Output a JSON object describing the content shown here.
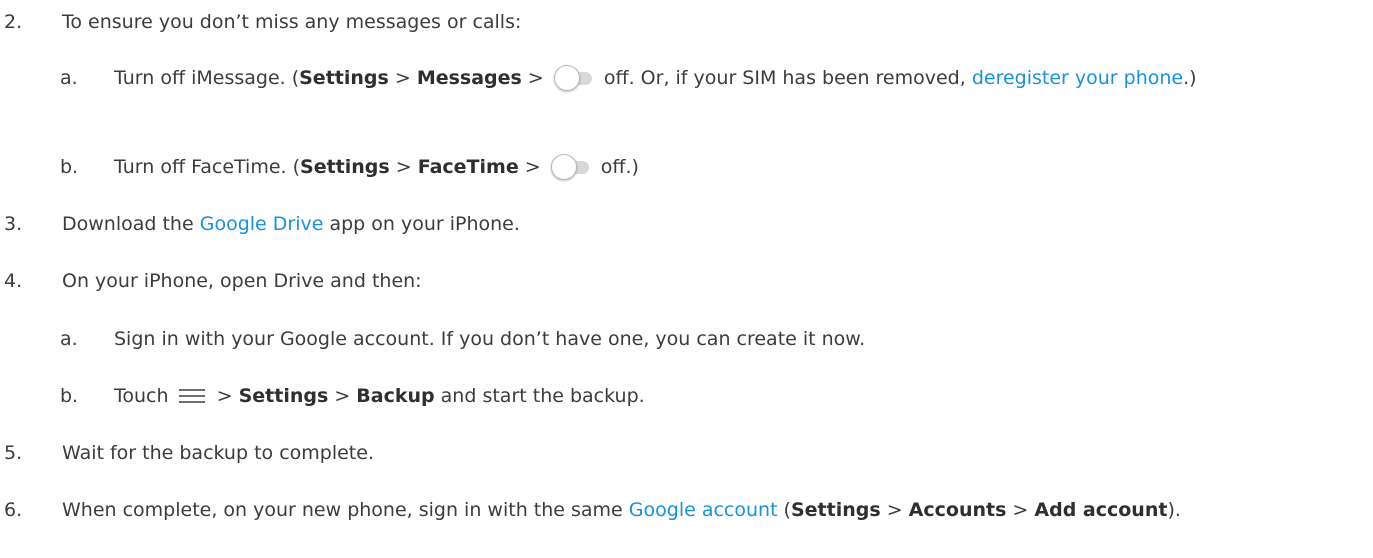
{
  "steps": [
    {
      "num": "2.",
      "text": "To ensure you don’t miss any messages or calls:"
    },
    {
      "num": "3.",
      "before": "Download the ",
      "link": "Google Drive",
      "after": " app on your iPhone."
    },
    {
      "num": "4.",
      "text": "On your iPhone, open Drive and then:"
    },
    {
      "num": "5.",
      "text": "Wait for the backup to complete."
    },
    {
      "num": "6.",
      "before": "When complete, on your new phone, sign in with the same ",
      "link": "Google account",
      "paren_open": " (",
      "b1": "Settings",
      "sep": " > ",
      "b2": "Accounts",
      "b3": "Add account",
      "close": ")."
    }
  ],
  "step2": {
    "a": {
      "letter": "a.",
      "before": "Turn off iMessage. (",
      "b1": "Settings",
      "sep": " > ",
      "b2": "Messages",
      "mid": " off. Or, if your SIM has been removed, ",
      "link": "deregister your phone",
      "close": ".)"
    },
    "b": {
      "letter": "b.",
      "before": "Turn off FaceTime. (",
      "b1": "Settings",
      "sep": " > ",
      "b2": "FaceTime",
      "close": " off.)"
    }
  },
  "step4": {
    "a": {
      "letter": "a.",
      "text": "Sign in with your Google account. If you don’t have one, you can create it now."
    },
    "b": {
      "letter": "b.",
      "before": "Touch",
      "sep": " > ",
      "b1": "Settings",
      "b2": "Backup",
      "after": " and start the backup."
    }
  },
  "icons": {
    "toggle": "toggle-off-icon",
    "menu": "hamburger-menu-icon"
  },
  "colors": {
    "text": "#3c3c3c",
    "link": "#1a91d9"
  }
}
